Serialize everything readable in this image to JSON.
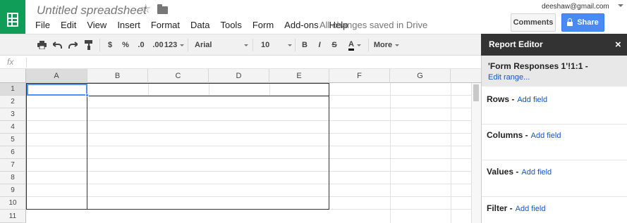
{
  "header": {
    "doc_title": "Untitled spreadsheet",
    "star_icon": "star-icon",
    "folder_icon": "folder-icon",
    "user_email": "deeshaw@gmail.com",
    "comments_label": "Comments",
    "share_label": "Share",
    "save_status": "All changes saved in Drive"
  },
  "menu": [
    "File",
    "Edit",
    "View",
    "Insert",
    "Format",
    "Data",
    "Tools",
    "Form",
    "Add-ons",
    "Help"
  ],
  "toolbar": {
    "currency": "$",
    "percent": "%",
    "decrease_decimals": ".0",
    "increase_decimals": ".00",
    "more_formats": "123",
    "font": "Arial",
    "font_size": "10",
    "bold": "B",
    "italic": "I",
    "strikethrough": "S",
    "text_color": "A",
    "more": "More"
  },
  "formula_bar": {
    "fx_label": "fx",
    "value": ""
  },
  "grid": {
    "columns": [
      "A",
      "B",
      "C",
      "D",
      "E",
      "F",
      "G"
    ],
    "rows": [
      "1",
      "2",
      "3",
      "4",
      "5",
      "6",
      "7",
      "8",
      "9",
      "10",
      "11"
    ],
    "selected_cell": "A1"
  },
  "report_editor": {
    "title": "Report Editor",
    "close_label": "×",
    "range": "'Form Responses 1'!1:1 -",
    "edit_range": "Edit range...",
    "sections": [
      {
        "label": "Rows -",
        "action": "Add field"
      },
      {
        "label": "Columns -",
        "action": "Add field"
      },
      {
        "label": "Values -",
        "action": "Add field"
      },
      {
        "label": "Filter -",
        "action": "Add field"
      }
    ]
  },
  "colors": {
    "accent": "#4a8af4",
    "logo": "#0f9d58",
    "panel_header": "#333333",
    "link": "#1155cc"
  }
}
